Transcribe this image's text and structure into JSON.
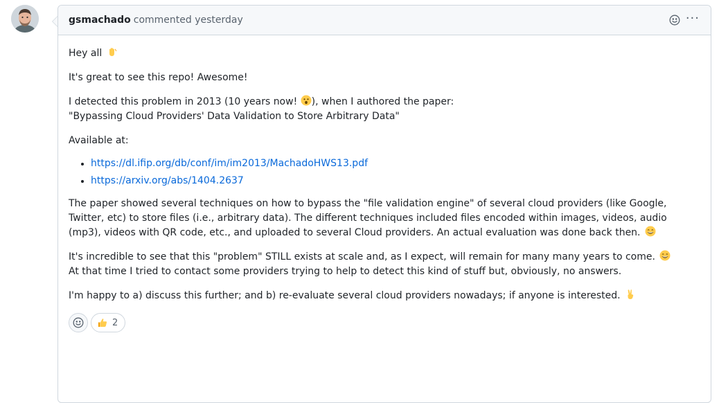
{
  "comment": {
    "author": "gsmachado",
    "meta": "commented yesterday",
    "avatar_icon": "user-avatar",
    "kebab": "···",
    "body": {
      "greeting": "Hey all",
      "greeting_emoji": "waving-hand-emoji",
      "p2": "It's great to see this repo! Awesome!",
      "p3_line1_a": "I detected this problem in 2013 (10 years now! ",
      "p3_line1_emoji": "astonished-face-emoji",
      "p3_line1_b": "), when I authored the paper:",
      "p3_line2": "\"Bypassing Cloud Providers' Data Validation to Store Arbitrary Data\"",
      "available": "Available at:",
      "links": [
        "https://dl.ifip.org/db/conf/im/im2013/MachadoHWS13.pdf",
        "https://arxiv.org/abs/1404.2637"
      ],
      "p5": "The paper showed several techniques on how to bypass the \"file validation engine\" of several cloud providers (like Google, Twitter, etc) to store files (i.e., arbitrary data). The different techniques included files encoded within images, videos, audio (mp3), videos with QR code, etc., and uploaded to several Cloud providers. An actual evaluation was done back then.",
      "p6_a": "It's incredible to see that this \"problem\" STILL exists at scale and, as I expect, will remain for many many years to come.",
      "p6_b": "At that time I tried to contact some providers trying to help to detect this kind of stuff but, obviously, no answers.",
      "p7": "I'm happy to a) discuss this further; and b) re-evaluate several cloud providers nowadays; if anyone is interested."
    },
    "reactions": {
      "thumbs_up_count": "2"
    }
  },
  "colors": {
    "link": "#0969da",
    "border": "#d0d7de",
    "header_bg": "#f6f8fa",
    "muted": "#59636e",
    "emoji_yellow": "#ffcc4d"
  }
}
